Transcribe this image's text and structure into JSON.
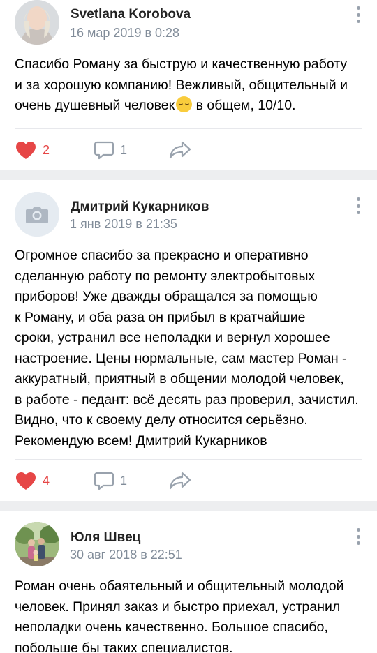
{
  "posts": [
    {
      "author": "Svetlana Korobova",
      "date": "16 мар 2019 в 0:28",
      "lines": [
        "Спасибо Роману за быструю и качественную работу",
        "и за хорошую компанию! Вежливый, общительный и",
        "очень душевный человек",
        " в общем, 10/10."
      ],
      "emoji": "relieved-face-emoji",
      "likes": "2",
      "comments": "1"
    },
    {
      "author": "Дмитрий Кукарников",
      "date": "1 янв 2019 в 21:35",
      "lines": [
        "Огромное спасибо за прекрасно и оперативно",
        "сделанную работу по ремонту электробытовых",
        "приборов! Уже дважды обращался за помощью",
        "к Роману, и оба раза он прибыл в кратчайшие",
        "сроки, устранил все неполадки и вернул хорошее",
        "настроение. Цены нормальные, сам мастер Роман -",
        "аккуратный, приятный в общении молодой человек,",
        "в работе - педант: всё десять раз проверил, зачистил.",
        "Видно, что к своему делу относится серьёзно.",
        "Рекомендую всем! Дмитрий Кукарников"
      ],
      "likes": "4",
      "comments": "1"
    },
    {
      "author": "Юля Швец",
      "date": "30 авг 2018 в 22:51",
      "lines": [
        "Роман очень обаятельный и общительный молодой",
        "человек.  Принял заказ и быстро приехал,  устранил",
        "неполадки очень качественно.  Большое спасибо,",
        "побольше бы таких специалистов."
      ]
    }
  ],
  "icons": {
    "like": "heart-icon",
    "comment": "comment-icon",
    "share": "share-icon",
    "more": "more-vertical-icon",
    "camera": "camera-icon"
  },
  "colors": {
    "like_active": "#e64646",
    "meta_gray": "#818c99",
    "icon_gray": "#99a2ad",
    "separator": "#edeef0"
  }
}
